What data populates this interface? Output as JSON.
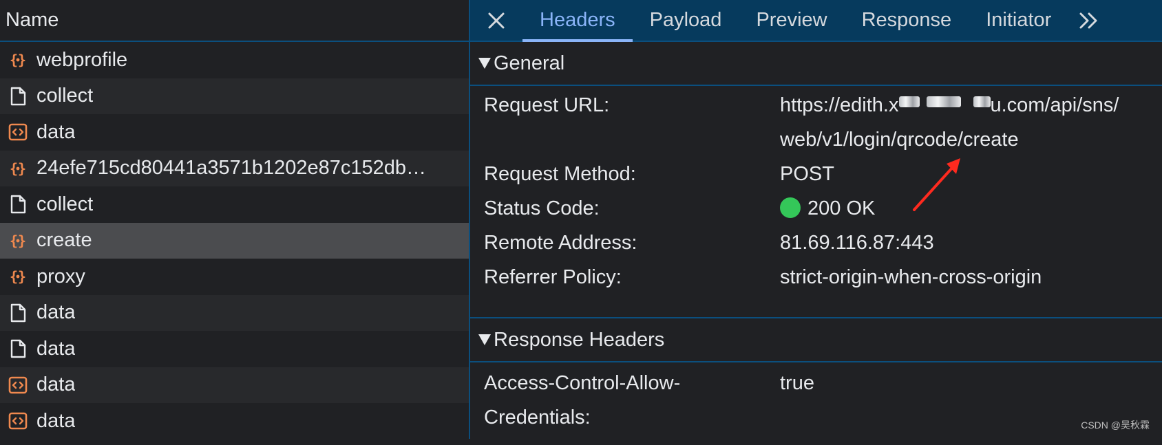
{
  "list": {
    "header": "Name",
    "rows": [
      {
        "icon": "fetch-icon",
        "name": "webprofile"
      },
      {
        "icon": "document-icon",
        "name": "collect"
      },
      {
        "icon": "xhr-icon",
        "name": "data"
      },
      {
        "icon": "fetch-icon",
        "name": "24efe715cd80441a3571b1202e87c152db…"
      },
      {
        "icon": "document-icon",
        "name": "collect"
      },
      {
        "icon": "fetch-icon",
        "name": "create"
      },
      {
        "icon": "fetch-icon",
        "name": "proxy"
      },
      {
        "icon": "document-icon",
        "name": "data"
      },
      {
        "icon": "document-icon",
        "name": "data"
      },
      {
        "icon": "xhr-icon",
        "name": "data"
      },
      {
        "icon": "xhr-icon",
        "name": "data"
      }
    ]
  },
  "tabs": [
    "Headers",
    "Payload",
    "Preview",
    "Response",
    "Initiator"
  ],
  "general": {
    "title": "General",
    "request_url_label": "Request URL:",
    "request_url_part1a": "https://edith.x",
    "request_url_part1b": "u.com/api/sns/",
    "request_url_part2": "web/v1/login/qrcode/create",
    "method_label": "Request Method:",
    "method": "POST",
    "status_label": "Status Code:",
    "status": "200 OK",
    "remote_label": "Remote Address:",
    "remote": "81.69.116.87:443",
    "referrer_label": "Referrer Policy:",
    "referrer": "strict-origin-when-cross-origin"
  },
  "response_headers": {
    "title": "Response Headers",
    "acac_label_1": "Access-Control-Allow-",
    "acac_label_2": "Credentials:",
    "acac_value": "true"
  },
  "watermark": "CSDN @吴秋霖",
  "colors": {
    "accent": "#8ab4f8",
    "status_ok": "#34c759",
    "arrow": "#ff2a1f",
    "fetch_icon": "#f0894f"
  }
}
